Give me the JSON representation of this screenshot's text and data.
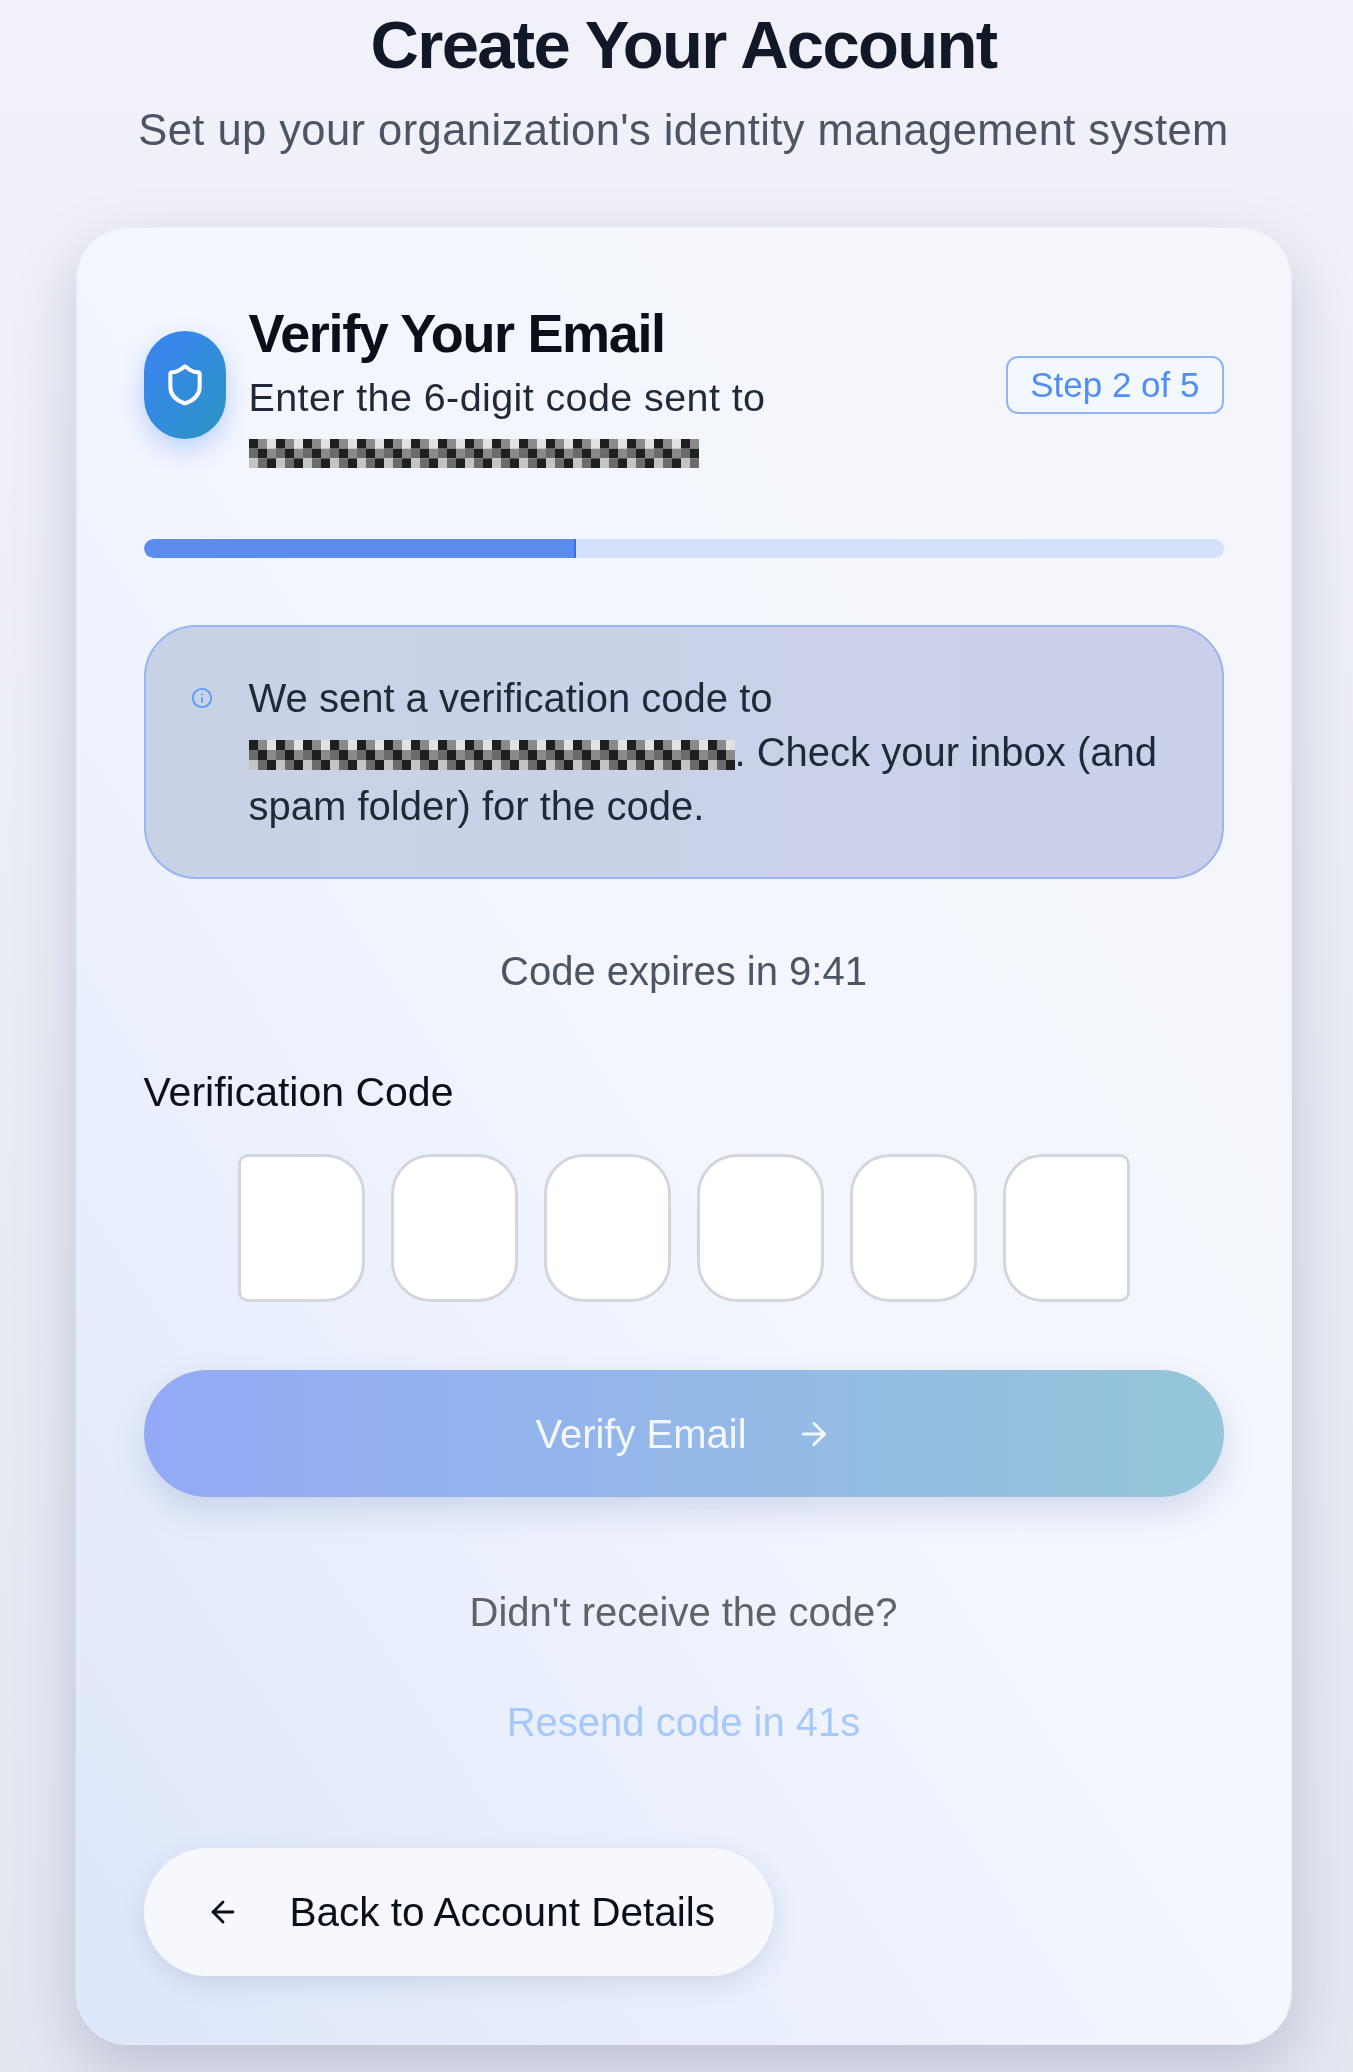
{
  "title": "Create Your Account",
  "subtitle": "Set up your organization's identity management system",
  "card": {
    "heading": "Verify Your Email",
    "description": "Enter the 6-digit code sent to",
    "step_badge": "Step 2 of 5",
    "progress": {
      "level": 0.4
    },
    "notice": {
      "text_before": "We sent a verification code to",
      "text_after": ". Check your inbox (and spam folder) for the code."
    },
    "expiry": "Code expires in 9:41",
    "code_input": {
      "label": "Verification Code",
      "digits": [
        {
          "kind": "digit"
        },
        {
          "kind": "digit"
        },
        {
          "kind": "digit"
        },
        {
          "kind": "digit"
        },
        {
          "kind": "digit"
        },
        {
          "kind": "digit"
        }
      ]
    },
    "verify_button": {
      "label": "Verify Email",
      "disabled": true
    },
    "resend_prompt": "Didn't receive the code?",
    "resend_button": {
      "label": "Resend code in 41s",
      "disabled": true
    },
    "back_button": {
      "label": "Back to Account Details"
    }
  }
}
